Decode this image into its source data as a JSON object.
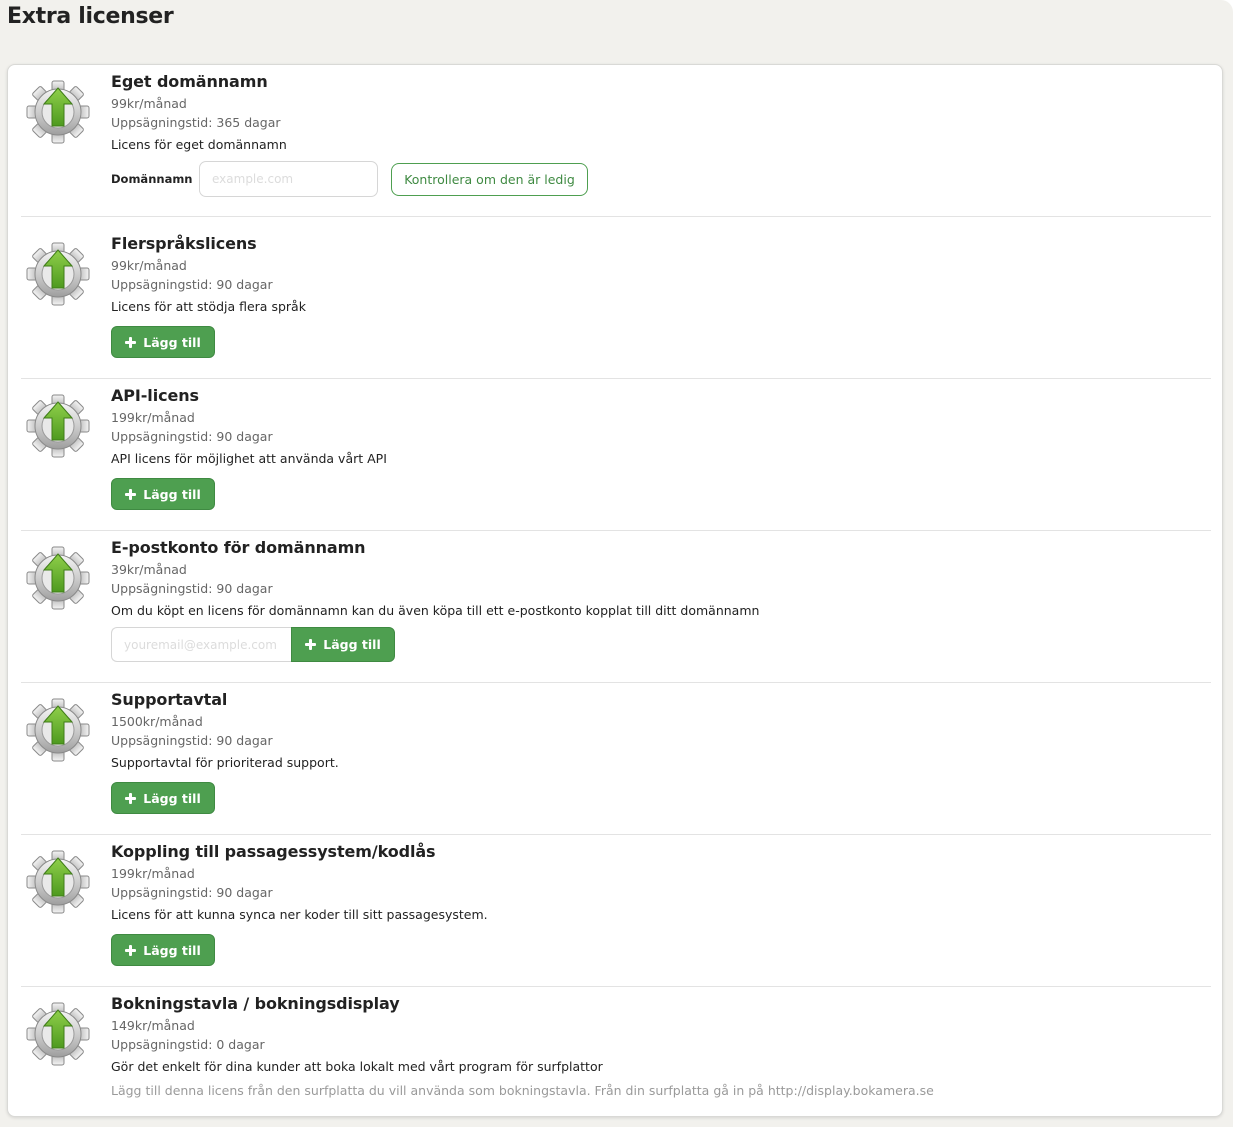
{
  "page": {
    "title": "Extra licenser"
  },
  "common": {
    "notice_prefix": "Uppsägningstid: ",
    "add_label": "Lägg till"
  },
  "licenses": [
    {
      "title": "Eget domännamn",
      "price": "99kr/månad",
      "notice": "Uppsägningstid: 365 dagar",
      "description": "Licens för eget domännamn",
      "domain_label": "Domännamn",
      "domain_placeholder": "example.com",
      "check_button": "Kontrollera om den är ledig"
    },
    {
      "title": "Flerspråkslicens",
      "price": "99kr/månad",
      "notice": "Uppsägningstid: 90 dagar",
      "description": "Licens för att stödja flera språk",
      "add_button": "Lägg till"
    },
    {
      "title": "API-licens",
      "price": "199kr/månad",
      "notice": "Uppsägningstid: 90 dagar",
      "description": "API licens för möjlighet att använda vårt API",
      "add_button": "Lägg till"
    },
    {
      "title": "E-postkonto för domännamn",
      "price": "39kr/månad",
      "notice": "Uppsägningstid: 90 dagar",
      "description": "Om du köpt en licens för domännamn kan du även köpa till ett e-postkonto kopplat till ditt domännamn",
      "email_placeholder": "youremail@example.com",
      "add_button": "Lägg till"
    },
    {
      "title": "Supportavtal",
      "price": "1500kr/månad",
      "notice": "Uppsägningstid: 90 dagar",
      "description": "Supportavtal för prioriterad support.",
      "add_button": "Lägg till"
    },
    {
      "title": "Koppling till passagessystem/kodlås",
      "price": "199kr/månad",
      "notice": "Uppsägningstid: 90 dagar",
      "description": "Licens för att kunna synca ner koder till sitt passagesystem.",
      "add_button": "Lägg till"
    },
    {
      "title": "Bokningstavla / bokningsdisplay",
      "price": "149kr/månad",
      "notice": "Uppsägningstid: 0 dagar",
      "description": "Gör det enkelt för dina kunder att boka lokalt med vårt program för surfplattor",
      "note": "Lägg till denna licens från den surfplatta du vill använda som bokningstavla. Från din surfplatta gå in på http://display.bokamera.se"
    }
  ],
  "colors": {
    "accent": "#4e9f50",
    "page_bg": "#f2f1ed",
    "muted_text": "#666666",
    "note_text": "#9a9a9a"
  },
  "icons": {
    "license_icon": "gear-upgrade-icon",
    "add_icon": "plus-icon"
  }
}
